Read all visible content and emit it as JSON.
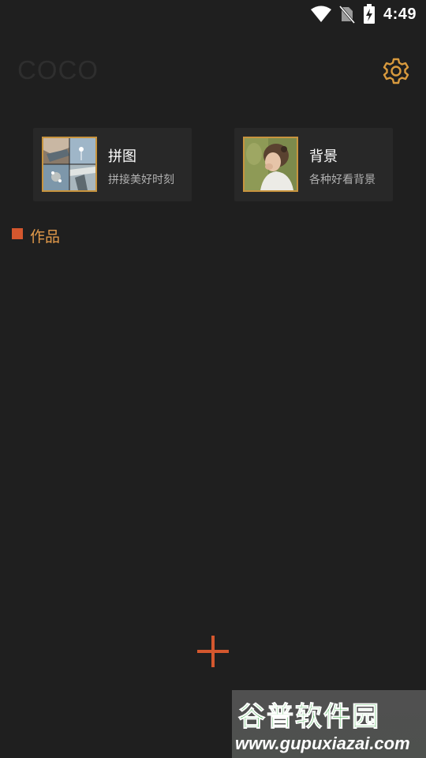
{
  "status_bar": {
    "time": "4:49",
    "icons": [
      "wifi-icon",
      "no-sim-icon",
      "battery-charging-icon"
    ]
  },
  "header": {
    "title": "COCO",
    "settings_icon": "gear-icon"
  },
  "cards": [
    {
      "title": "拼图",
      "subtitle": "拼接美好时刻",
      "thumbnail": "collage-photo-grid"
    },
    {
      "title": "背景",
      "subtitle": "各种好看背景",
      "thumbnail": "woman-portrait-photo"
    }
  ],
  "section": {
    "title": "作品"
  },
  "add_button": {
    "icon": "plus-icon"
  },
  "watermark": {
    "name": "谷普软件园",
    "url": "www.gupuxiazai.com"
  },
  "colors": {
    "background": "#1f1f1f",
    "card": "#282828",
    "accent_gold": "#c8943e",
    "accent_red": "#d4572e",
    "section_title": "#e29a4a"
  }
}
